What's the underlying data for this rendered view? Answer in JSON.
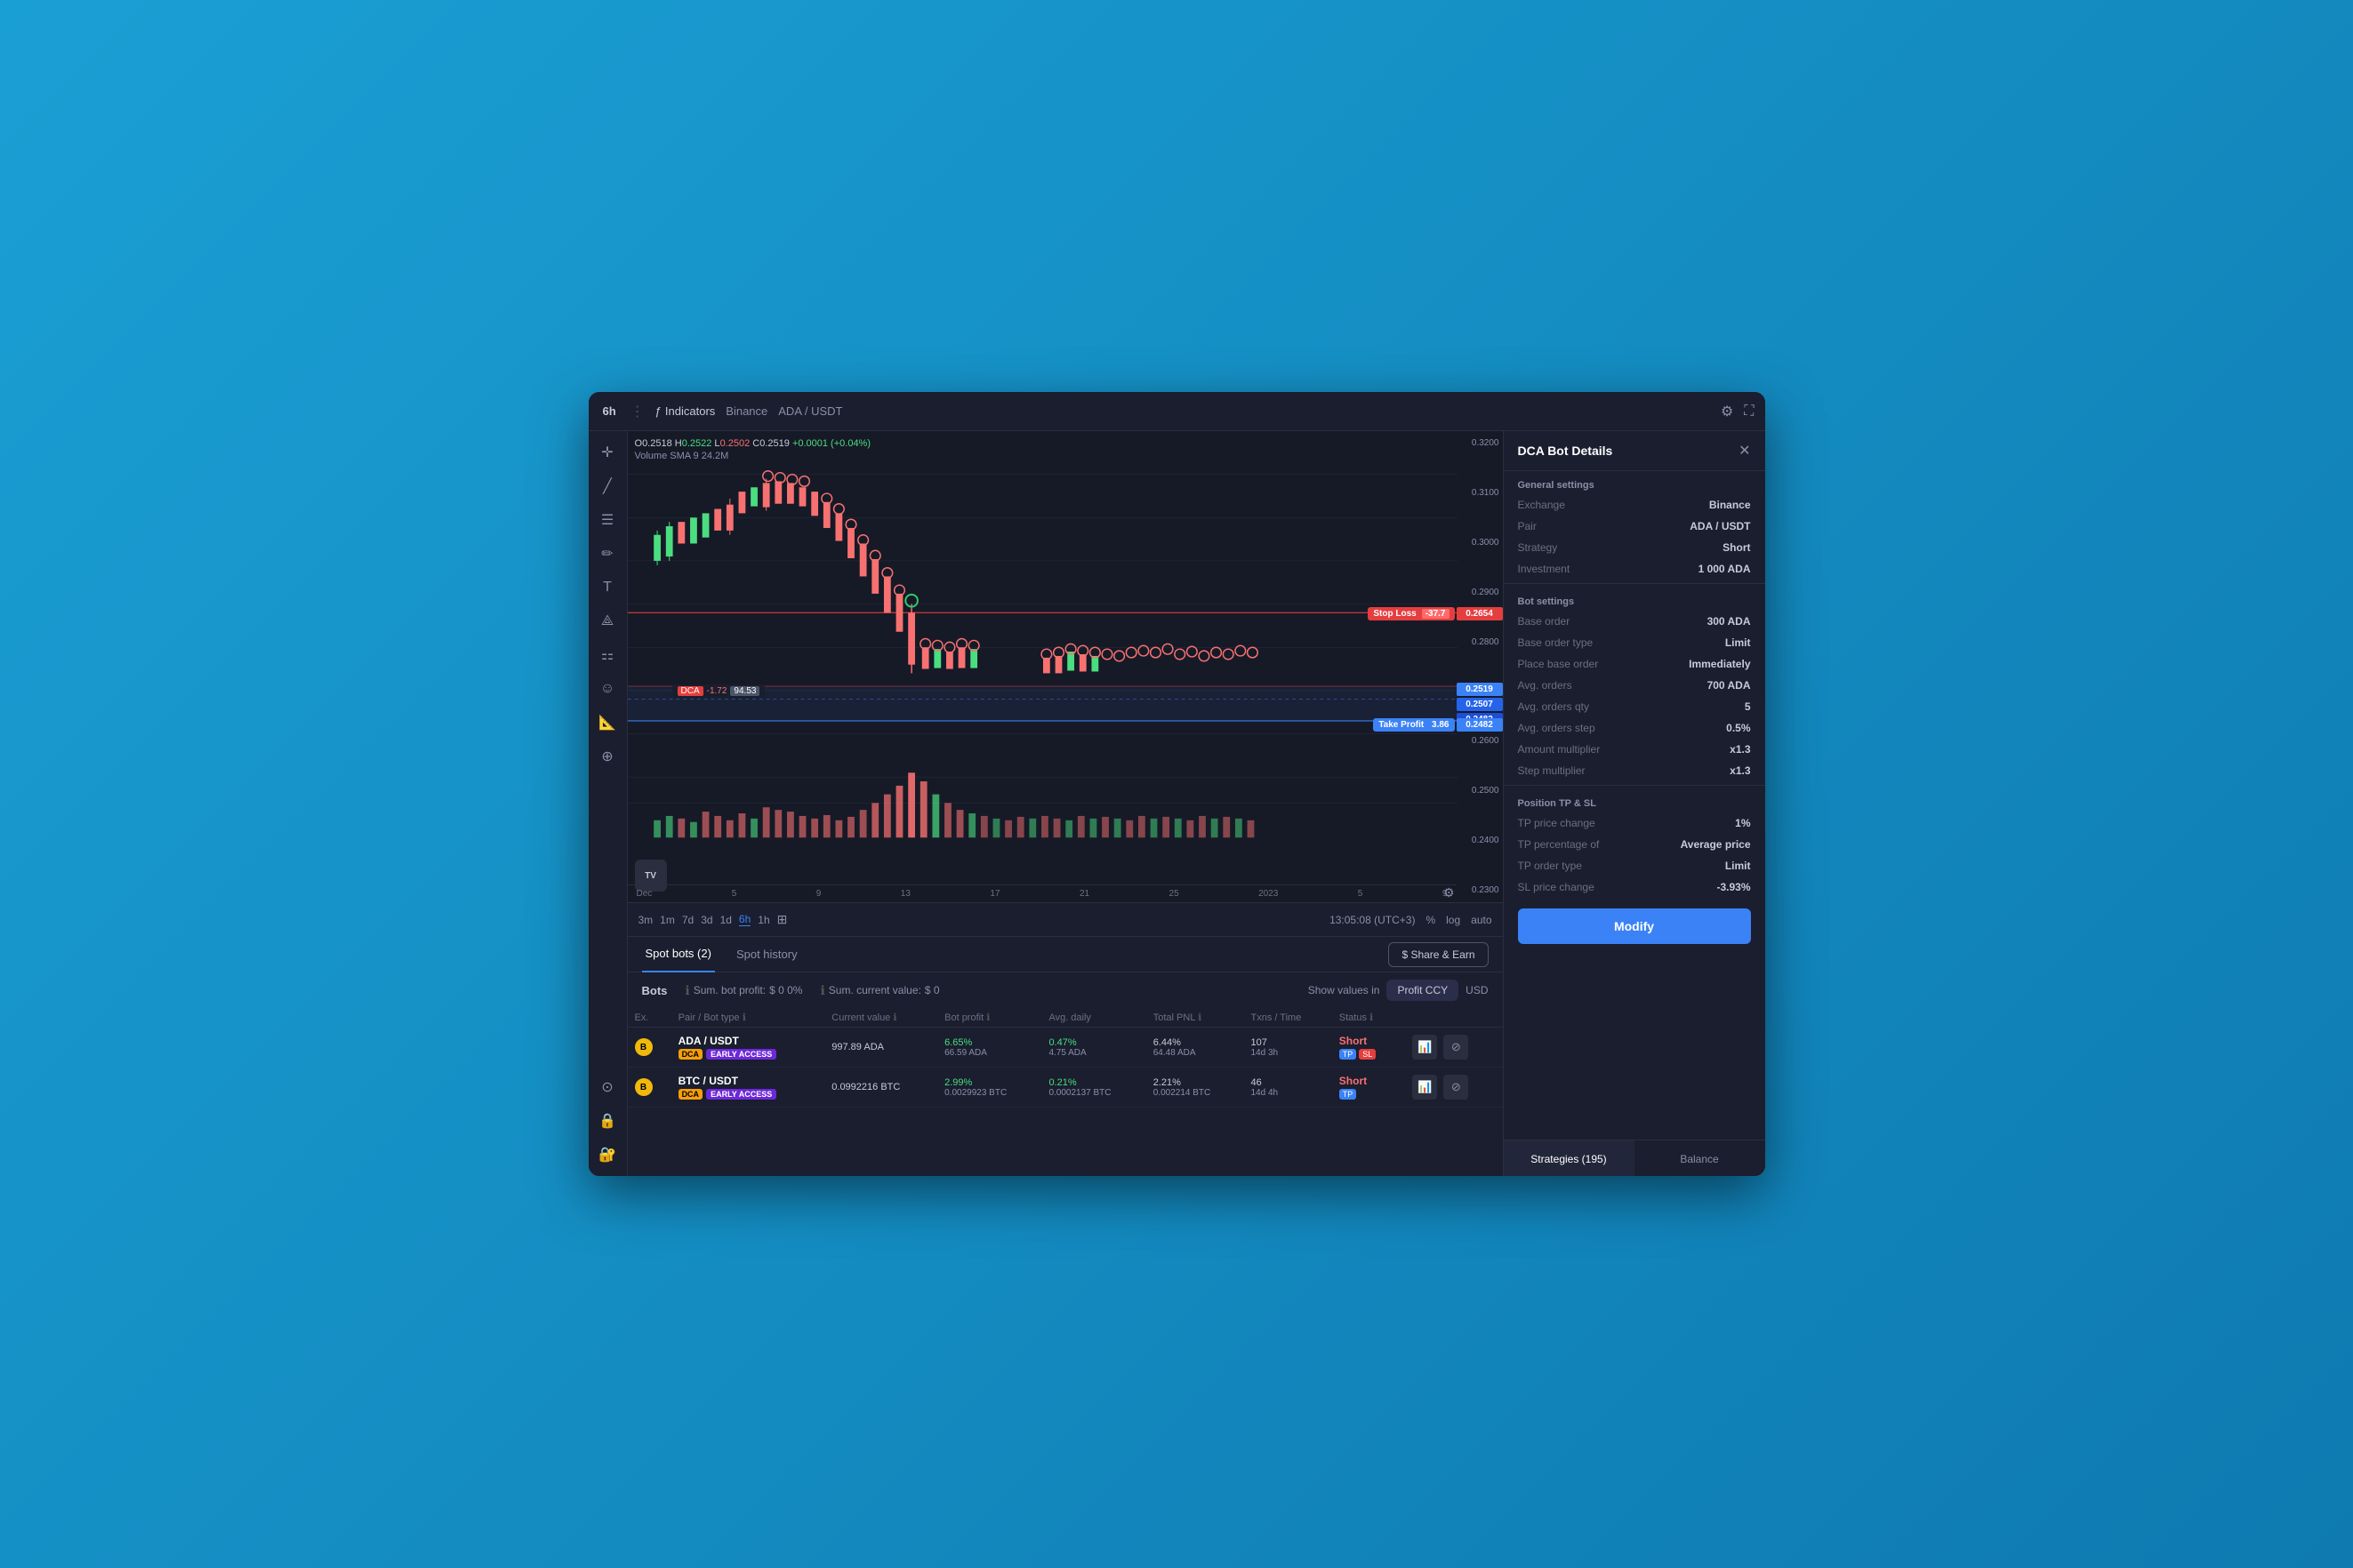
{
  "app": {
    "title": "DCA Bot Details"
  },
  "topbar": {
    "timeframe": "6h",
    "indicators_label": "Indicators",
    "exchange": "Binance",
    "pair": "ADA / USDT"
  },
  "chart": {
    "ohlc": {
      "open": "0.2518",
      "high": "0.2522",
      "low": "0.2502",
      "close": "0.2519",
      "change": "+0.0001 (+0.04%)"
    },
    "volume_sma": "Volume SMA 9",
    "volume_sma_value": "24.2M",
    "stop_loss_label": "Stop Loss",
    "stop_loss_value": "-37.7",
    "stop_loss_price": "0.2654",
    "dca_label": "DCA",
    "dca_value": "-1.72",
    "dca_total": "94.53",
    "take_profit_label": "Take Profit",
    "take_profit_value": "3.86",
    "price_markers": [
      "0.2519",
      "0.2507",
      "0.2482"
    ],
    "price_axis": [
      "0.3200",
      "0.3100",
      "0.3000",
      "0.2900",
      "0.2800",
      "0.2700",
      "0.2600",
      "0.2500",
      "0.2400",
      "0.2300"
    ],
    "date_axis": [
      "Dec",
      "5",
      "9",
      "13",
      "17",
      "21",
      "25",
      "2023",
      "5",
      "9"
    ],
    "time_display": "13:05:08 (UTC+3)"
  },
  "timeframes": {
    "items": [
      "3m",
      "1m",
      "7d",
      "3d",
      "1d",
      "6h",
      "1h"
    ],
    "active": "6h"
  },
  "tabs": {
    "items": [
      {
        "label": "Spot bots (2)",
        "active": true
      },
      {
        "label": "Spot history",
        "active": false
      }
    ],
    "share_earn_label": "$ Share & Earn"
  },
  "bots_section": {
    "title": "Bots",
    "sum_profit_label": "Sum. bot profit:",
    "sum_profit_value": "$ 0 0%",
    "sum_current_label": "Sum. current value:",
    "sum_current_value": "$ 0",
    "show_values_label": "Show values in",
    "profit_ccy_label": "Profit CCY",
    "usd_label": "USD"
  },
  "table": {
    "headers": [
      "Ex.",
      "Pair / Bot type",
      "Current value",
      "Bot profit",
      "Avg. daily",
      "Total PNL",
      "Txns / Time",
      "Status"
    ],
    "rows": [
      {
        "exchange_icon": "B",
        "pair": "ADA / USDT",
        "bot_type": "DCA",
        "access": "EARLY ACCESS",
        "current_value": "997.89 ADA",
        "bot_profit_pct": "6.65%",
        "bot_profit_val": "66.59 ADA",
        "avg_daily_pct": "0.47%",
        "avg_daily_val": "4.75 ADA",
        "total_pnl_pct": "6.44%",
        "total_pnl_val": "64.48 ADA",
        "txns": "107",
        "time": "14d 3h",
        "status": "Short",
        "tp": true,
        "sl": true
      },
      {
        "exchange_icon": "B",
        "pair": "BTC / USDT",
        "bot_type": "DCA",
        "access": "EARLY ACCESS",
        "current_value": "0.0992216 BTC",
        "bot_profit_pct": "2.99%",
        "bot_profit_val": "0.0029923 BTC",
        "avg_daily_pct": "0.21%",
        "avg_daily_val": "0.0002137 BTC",
        "total_pnl_pct": "2.21%",
        "total_pnl_val": "0.002214 BTC",
        "txns": "46",
        "time": "14d 4h",
        "status": "Short",
        "tp": true,
        "sl": false
      }
    ]
  },
  "right_panel": {
    "title": "DCA Bot Details",
    "sections": {
      "general": {
        "title": "General settings",
        "rows": [
          {
            "label": "Exchange",
            "value": "Binance"
          },
          {
            "label": "Pair",
            "value": "ADA / USDT"
          },
          {
            "label": "Strategy",
            "value": "Short"
          },
          {
            "label": "Investment",
            "value": "1 000 ADA"
          }
        ]
      },
      "bot": {
        "title": "Bot settings",
        "rows": [
          {
            "label": "Base order",
            "value": "300 ADA"
          },
          {
            "label": "Base order type",
            "value": "Limit"
          },
          {
            "label": "Place base order",
            "value": "Immediately"
          },
          {
            "label": "Avg. orders",
            "value": "700 ADA"
          },
          {
            "label": "Avg. orders qty",
            "value": "5"
          },
          {
            "label": "Avg. orders step",
            "value": "0.5%"
          },
          {
            "label": "Amount multiplier",
            "value": "x1.3"
          },
          {
            "label": "Step multiplier",
            "value": "x1.3"
          }
        ]
      },
      "tp_sl": {
        "title": "Position TP & SL",
        "rows": [
          {
            "label": "TP price change",
            "value": "1%"
          },
          {
            "label": "TP percentage of",
            "value": "Average price"
          },
          {
            "label": "TP order type",
            "value": "Limit"
          },
          {
            "label": "SL price change",
            "value": "-3.93%"
          }
        ]
      }
    },
    "modify_label": "Modify",
    "bottom_tabs": [
      {
        "label": "Strategies (195)",
        "active": true
      },
      {
        "label": "Balance",
        "active": false
      }
    ]
  }
}
